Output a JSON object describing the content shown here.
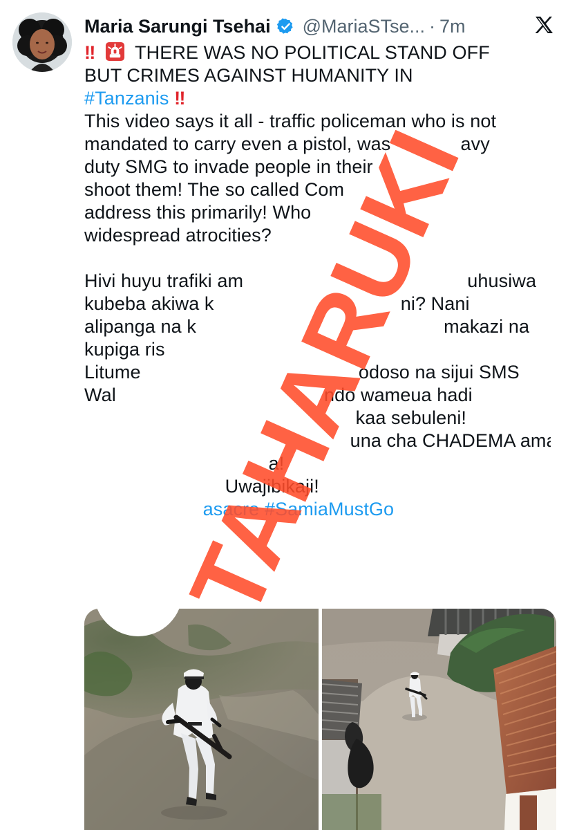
{
  "post": {
    "author": {
      "name": "Maria Sarungi Tsehai",
      "handle": "@MariaSTse...",
      "dot": "·",
      "time": "7m"
    },
    "text": {
      "line1_main": "THERE WAS NO POLITICAL STAND OFF",
      "line2": "BUT CRIMES AGAINST HUMANITY IN",
      "line3_hashtag": "#Tanzanis",
      "line4": "This video says it all - traffic policeman who is not",
      "line5": "mandated to carry even a pistol, was",
      "line5_tail": "avy",
      "line6": "duty SMG to invade people in their",
      "line7": "shoot them! The so called Com",
      "line8": "address this primarily! Who",
      "line9": "widespread atrocities?",
      "line11": "Hivi huyu trafiki am",
      "line11_tail": "uhusiwa",
      "line12": "kubeba akiwa k",
      "line12_tail": "ni? Nani",
      "line13": "alipanga na k",
      "line13_tail": "makazi na",
      "line14": "kupiga ris",
      "line15": "Litume",
      "line15_tail": "odoso na sijui SMS",
      "line16": "Wal",
      "line16_tail": "ndo wameua hadi",
      "line17_tail": "kaa sebuleni!",
      "line18_tail": "una cha CHADEMA ama",
      "line19_tail": "a!",
      "line20_tail": "Uwajibikaji!",
      "line21_hashtag_partial": "asacre",
      "line21_hashtag": "#SamiaMustGo"
    },
    "overlay": {
      "stamp_text": "TAHARUKI",
      "stamp_color": "#ff4c2a"
    },
    "icons": {
      "verified": "verified-badge-icon",
      "x_logo": "x-logo-icon",
      "siren": "police-light-icon",
      "exclamation": "double-exclamation-icon"
    },
    "colors": {
      "link": "#1d9bf0",
      "text": "#0f1419",
      "muted": "#536471",
      "alert": "#e0242b"
    }
  }
}
